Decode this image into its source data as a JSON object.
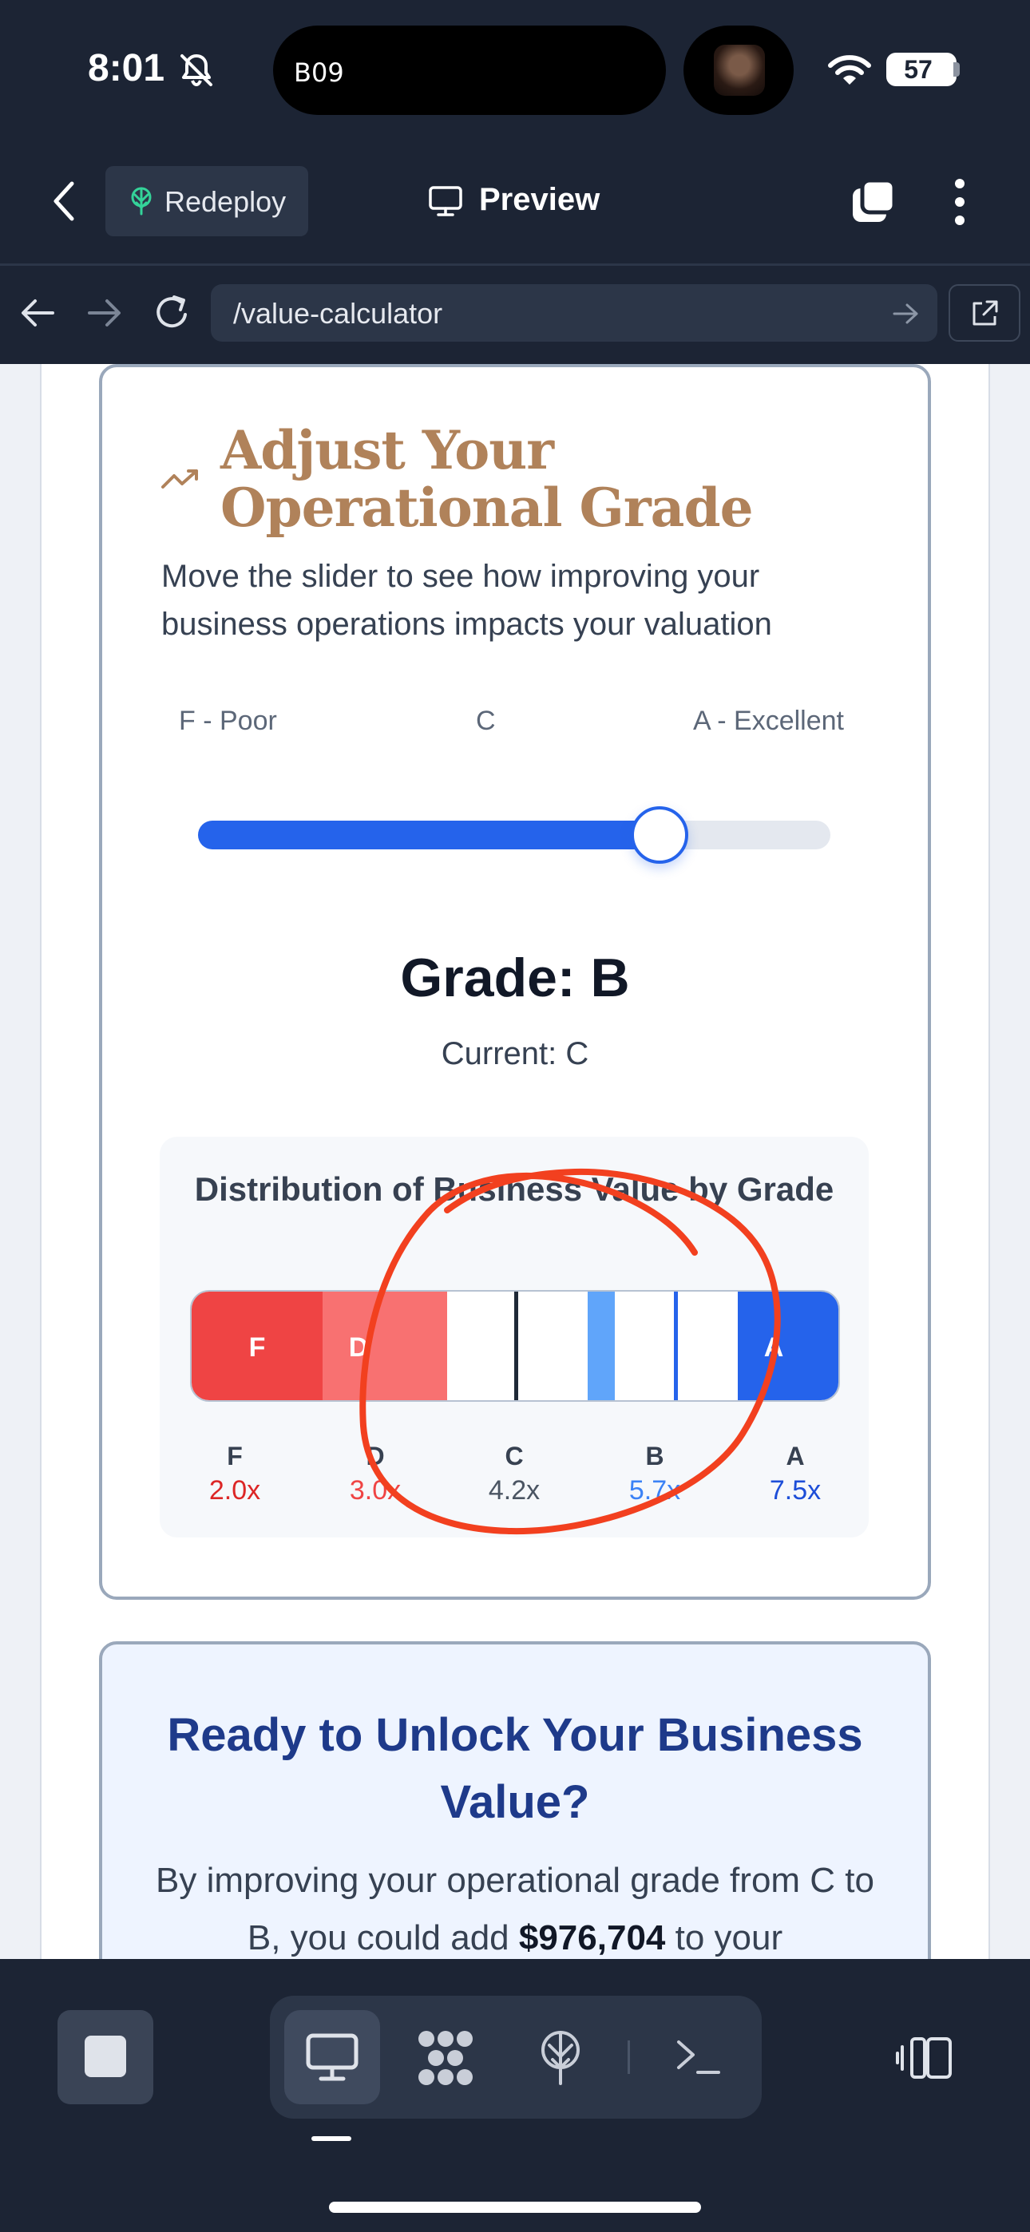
{
  "status_bar": {
    "time": "8:01",
    "island_text": "B09",
    "battery": "57"
  },
  "app_header": {
    "redeploy_label": "Redeploy",
    "preview_label": "Preview"
  },
  "nav": {
    "url": "/value-calculator"
  },
  "grade_card": {
    "title": "Adjust Your Operational Grade",
    "description": "Move the slider to see how improving your business operations impacts your valuation",
    "slider": {
      "left_label": "F - Poor",
      "mid_label": "C",
      "right_label": "A - Excellent",
      "value_fraction": 0.73
    },
    "grade_heading": "Grade: B",
    "current_label": "Current: C"
  },
  "distribution": {
    "title": "Distribution of Business Value by Grade",
    "bar_segments": [
      {
        "label": "F",
        "color": "#ef4444"
      },
      {
        "label": "D",
        "color": "#f87171"
      },
      {
        "label": "",
        "color": "#ffffff"
      },
      {
        "label": "",
        "color": "#ffffff"
      },
      {
        "label": "",
        "color": "#60a5fa"
      },
      {
        "label": "",
        "color": "#ffffff"
      },
      {
        "label": "A",
        "color": "#2563eb"
      }
    ],
    "grades": [
      {
        "grade": "F",
        "multiple": "2.0x",
        "color": "#dc2626"
      },
      {
        "grade": "D",
        "multiple": "3.0x",
        "color": "#ef4444"
      },
      {
        "grade": "C",
        "multiple": "4.2x",
        "color": "#4b5563"
      },
      {
        "grade": "B",
        "multiple": "5.7x",
        "color": "#3b82f6"
      },
      {
        "grade": "A",
        "multiple": "7.5x",
        "color": "#1d4ed8"
      }
    ]
  },
  "cta": {
    "title": "Ready to Unlock Your Business Value?",
    "body_prefix": "By improving your operational grade from C to B, you could add ",
    "body_amount": "$976,704",
    "body_suffix": " to your"
  },
  "annotation": {
    "color": "#f2401f"
  },
  "bottom_bar": {
    "active_tab": "preview"
  }
}
